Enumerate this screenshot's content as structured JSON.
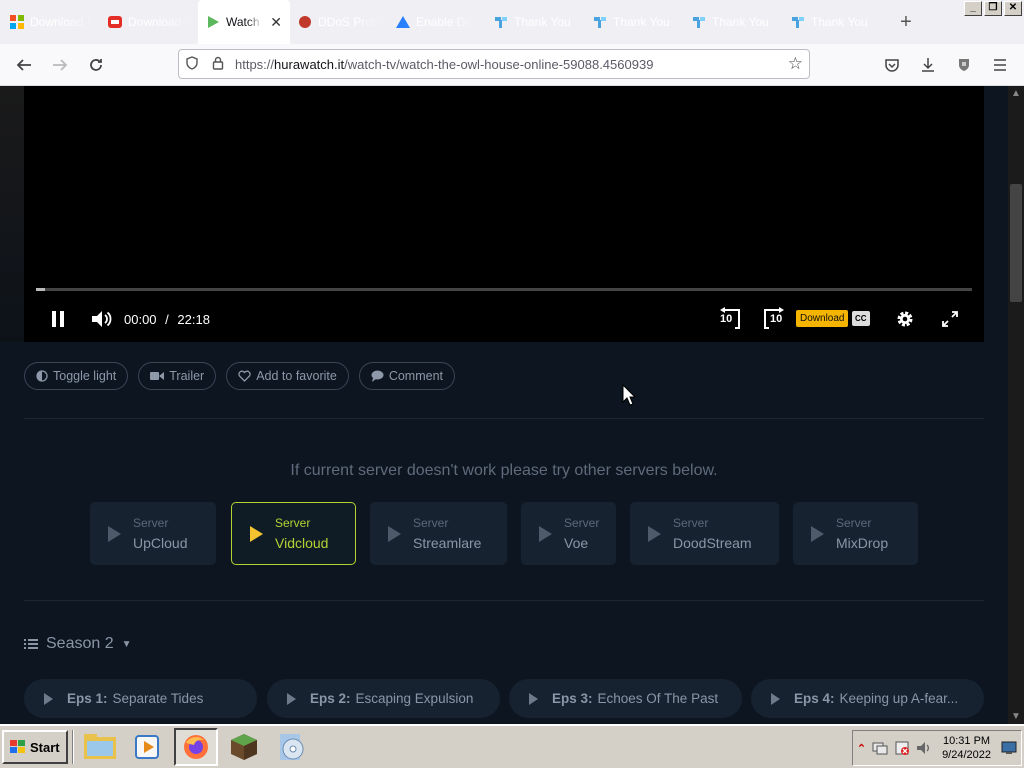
{
  "browser": {
    "tabs": [
      {
        "label": "Download M",
        "icon": "windows-logo-icon",
        "active": false
      },
      {
        "label": "Download Y",
        "icon": "youtube-downloader-icon",
        "active": false
      },
      {
        "label": "Watch T",
        "icon": "play-icon",
        "active": true
      },
      {
        "label": "DDoS Prote",
        "icon": "shield-icon",
        "active": false
      },
      {
        "label": "Enable Dre",
        "icon": "site-icon",
        "active": false
      },
      {
        "label": "Thank You",
        "icon": "thankyou-site-icon",
        "active": false
      },
      {
        "label": "Thank You",
        "icon": "thankyou-site-icon",
        "active": false
      },
      {
        "label": "Thank You",
        "icon": "thankyou-site-icon",
        "active": false
      },
      {
        "label": "Thank You",
        "icon": "thankyou-site-icon",
        "active": false
      }
    ],
    "url_prefix": "https://",
    "url_domain": "hurawatch.it",
    "url_path": "/watch-tv/watch-the-owl-house-online-59088.4560939"
  },
  "player": {
    "current_time": "00:00",
    "separator": "/",
    "duration": "22:18",
    "progress": 0.01,
    "download_label": "Download",
    "cc_label": "CC",
    "rewind_label": "10",
    "forward_label": "10"
  },
  "actions": [
    {
      "label": "Toggle light",
      "icon": "contrast-icon"
    },
    {
      "label": "Trailer",
      "icon": "video-camera-icon"
    },
    {
      "label": "Add to favorite",
      "icon": "heart-icon"
    },
    {
      "label": "Comment",
      "icon": "comment-icon"
    }
  ],
  "server_note": "If current server doesn't work please try other servers below.",
  "servers": [
    {
      "small": "Server",
      "name": "UpCloud",
      "active": false
    },
    {
      "small": "Server",
      "name": "Vidcloud",
      "active": true
    },
    {
      "small": "Server",
      "name": "Streamlare",
      "active": false
    },
    {
      "small": "Server",
      "name": "Voe",
      "active": false
    },
    {
      "small": "Server",
      "name": "DoodStream",
      "active": false
    },
    {
      "small": "Server",
      "name": "MixDrop",
      "active": false
    }
  ],
  "season": {
    "label": "Season 2"
  },
  "episodes": [
    {
      "num": "Eps 1:",
      "title": "Separate Tides"
    },
    {
      "num": "Eps 2:",
      "title": "Escaping Expulsion"
    },
    {
      "num": "Eps 3:",
      "title": "Echoes Of The Past"
    },
    {
      "num": "Eps 4:",
      "title": "Keeping up A-fear..."
    }
  ],
  "taskbar": {
    "start_label": "Start",
    "time": "10:31 PM",
    "date": "9/24/2022"
  },
  "colors": {
    "accent_server": "#b3d234",
    "download_badge": "#f4b400",
    "page_bg": "#0c1520"
  }
}
